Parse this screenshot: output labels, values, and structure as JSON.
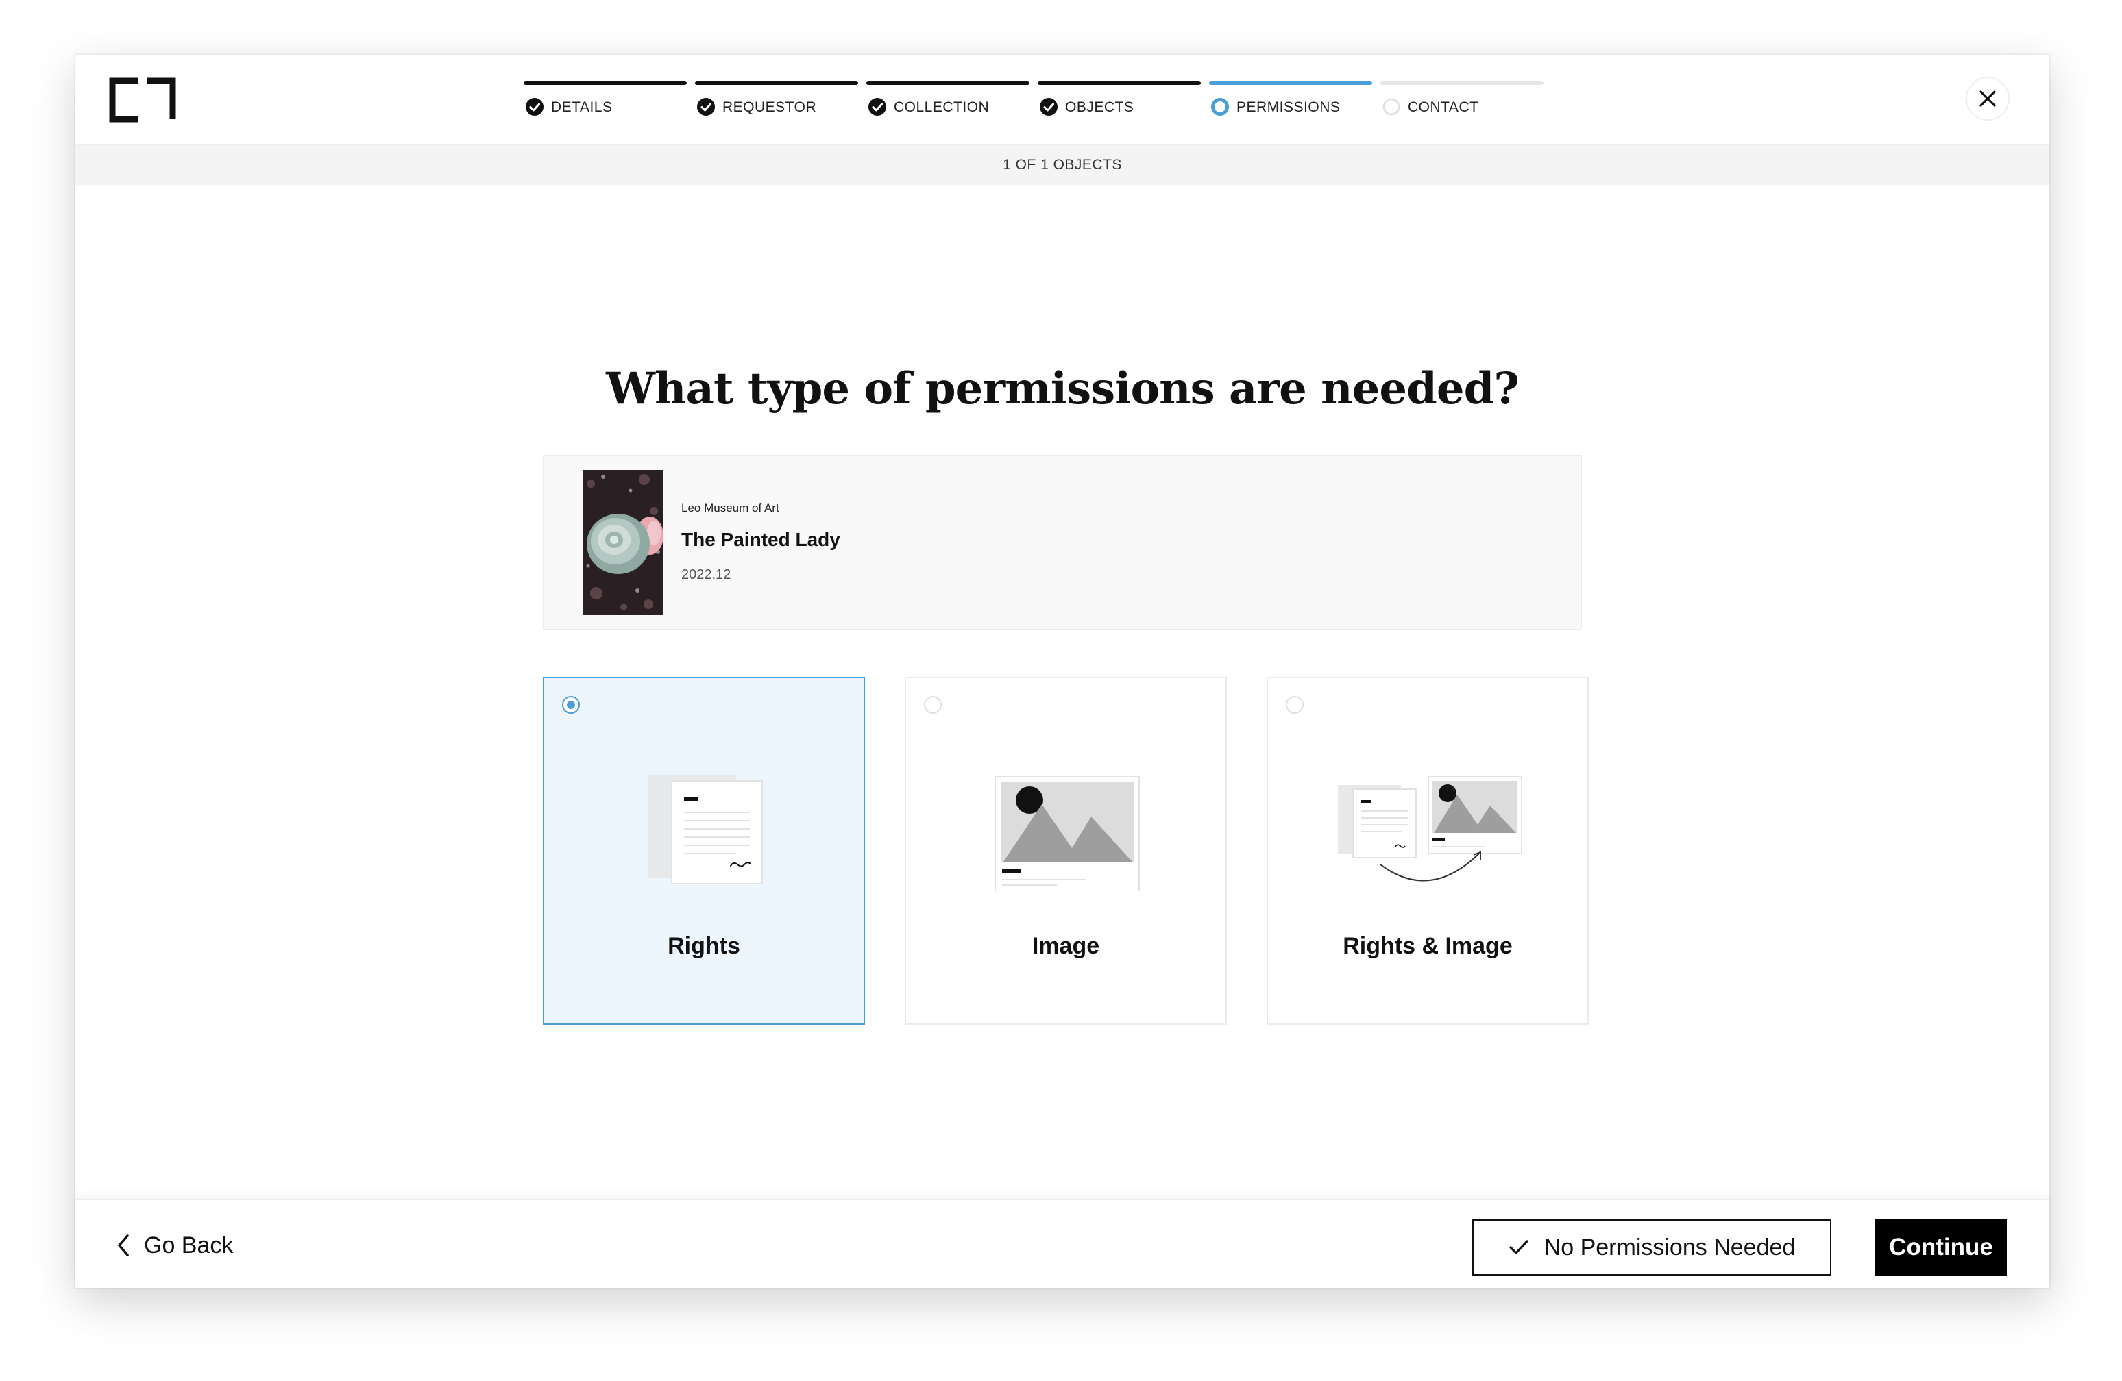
{
  "stepper": {
    "steps": [
      {
        "label": "DETAILS",
        "state": "complete"
      },
      {
        "label": "REQUESTOR",
        "state": "complete"
      },
      {
        "label": "COLLECTION",
        "state": "complete"
      },
      {
        "label": "OBJECTS",
        "state": "complete"
      },
      {
        "label": "PERMISSIONS",
        "state": "active"
      },
      {
        "label": "CONTACT",
        "state": "pending"
      }
    ]
  },
  "progress_text": "1 OF 1 OBJECTS",
  "main": {
    "title": "What type of permissions are needed?",
    "object": {
      "museum": "Leo Museum of Art",
      "title": "The Painted Lady",
      "date": "2022.12"
    },
    "options": [
      {
        "label": "Rights",
        "selected": true,
        "icon": "document-signature-icon"
      },
      {
        "label": "Image",
        "selected": false,
        "icon": "image-mountains-icon"
      },
      {
        "label": "Rights & Image",
        "selected": false,
        "icon": "rights-and-image-icon"
      }
    ]
  },
  "footer": {
    "back_label": "Go Back",
    "no_permissions_label": "No Permissions Needed",
    "continue_label": "Continue"
  },
  "colors": {
    "accent": "#4a9fd8",
    "selected_bg": "#eef6fd",
    "primary": "#000000"
  }
}
